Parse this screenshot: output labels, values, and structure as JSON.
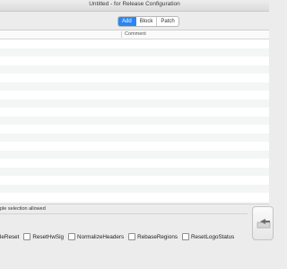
{
  "window": {
    "title": "Untitled - for Release Configuration",
    "corner_text": "..."
  },
  "segmented": {
    "items": [
      "Add",
      "Block",
      "Patch"
    ],
    "selected": "Add",
    "accent": "#2a86f4"
  },
  "table": {
    "columns": [
      "",
      "Comment"
    ],
    "rows": []
  },
  "footer_note": "ple selection allowed",
  "options": [
    {
      "label": "leReset",
      "checked": false
    },
    {
      "label": "ResetHwSig",
      "checked": false
    },
    {
      "label": "NormalizeHeaders",
      "checked": false
    },
    {
      "label": "RebaseRegions",
      "checked": false
    },
    {
      "label": "ResetLogoStatus",
      "checked": false
    }
  ],
  "side_button": {
    "icon": "import-arrow-icon"
  }
}
